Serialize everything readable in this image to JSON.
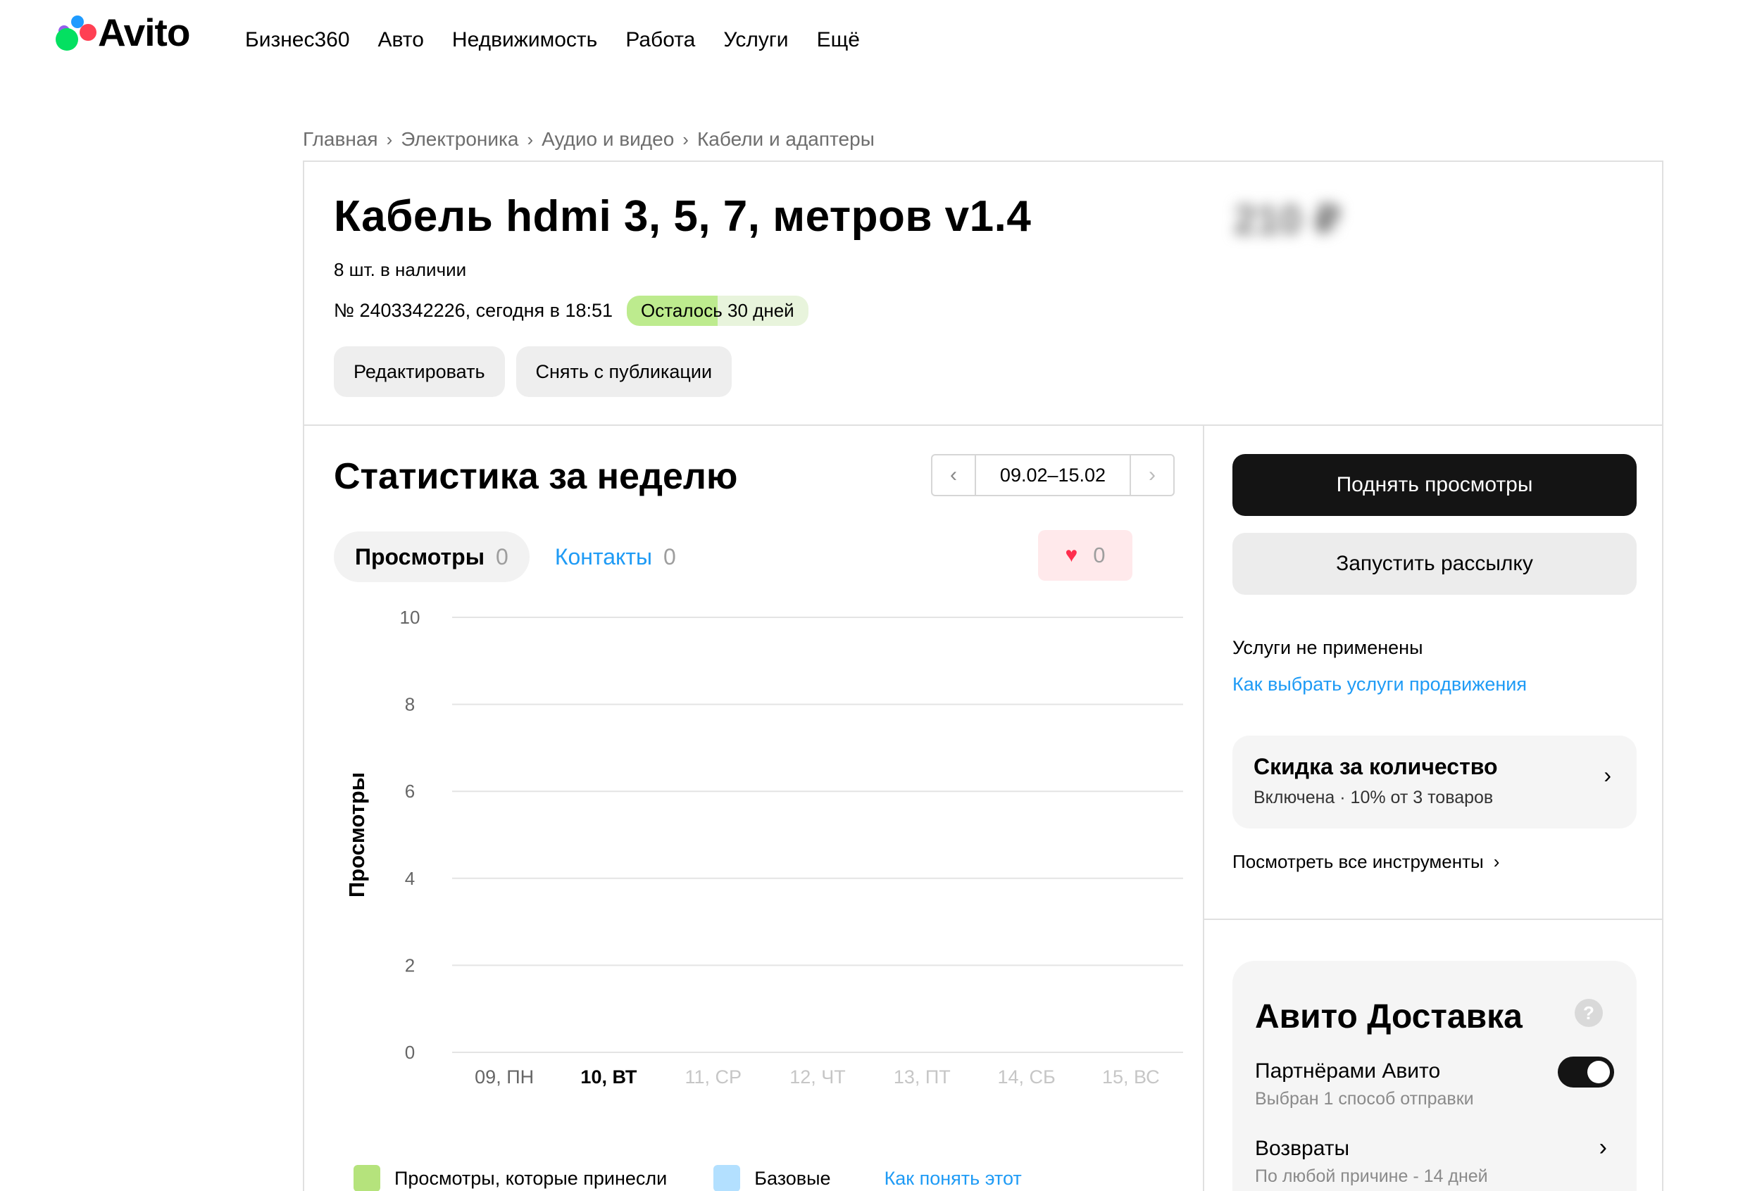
{
  "header": {
    "logo_text": "Avito",
    "nav": [
      "Бизнес360",
      "Авто",
      "Недвижимость",
      "Работа",
      "Услуги",
      "Ещё"
    ]
  },
  "breadcrumb": [
    "Главная",
    "Электроника",
    "Аудио и видео",
    "Кабели и адаптеры"
  ],
  "listing": {
    "title": "Кабель hdmi 3, 5, 7, метров v1.4",
    "price": "210 ₽",
    "stock": "8 шт. в наличии",
    "meta": "№ 2403342226, сегодня в 18:51",
    "days_left": "Осталось 30 дней",
    "edit_label": "Редактировать",
    "unpublish_label": "Снять с публикации"
  },
  "stats": {
    "title": "Статистика за неделю",
    "date_range": "09.02–15.02",
    "tab_views": "Просмотры",
    "tab_views_count": "0",
    "tab_contacts": "Контакты",
    "tab_contacts_count": "0",
    "favorites_count": "0",
    "legend_paid": "Просмотры, которые принесли",
    "legend_base": "Базовые",
    "legend_link": "Как понять этот"
  },
  "chart_data": {
    "type": "bar",
    "ylabel": "Просмотры",
    "ylim": [
      0,
      10
    ],
    "yticks": [
      "0",
      "2",
      "4",
      "6",
      "8",
      "10"
    ],
    "categories": [
      "09, ПН",
      "10, ВТ",
      "11, СР",
      "12, ЧТ",
      "13, ПТ",
      "14, СБ",
      "15, ВС"
    ],
    "active_category": "10, ВТ",
    "series": [
      {
        "name": "Просмотры, которые принесли",
        "color": "#b5e37c",
        "values": [
          0,
          0,
          0,
          0,
          0,
          0,
          0
        ]
      },
      {
        "name": "Базовые",
        "color": "#b3e0ff",
        "values": [
          0,
          0,
          0,
          0,
          0,
          0,
          0
        ]
      }
    ],
    "grid": true
  },
  "side": {
    "boost_label": "Поднять просмотры",
    "mailing_label": "Запустить рассылку",
    "no_services": "Услуги не применены",
    "how_link": "Как выбрать услуги продвижения",
    "discount_title": "Скидка за количество",
    "discount_sub": "Включена · 10% от 3 товаров",
    "all_tools": "Посмотреть все инструменты",
    "delivery_title": "Авито Доставка",
    "partners_label": "Партнёрами Авито",
    "partners_sub": "Выбран 1 способ отправки",
    "returns_label": "Возвраты",
    "returns_sub": "По любой причине - 14 дней"
  },
  "colors": {
    "accent_link": "#1f9bf5",
    "badge_green": "#bdeb8e",
    "dark_button": "#141414"
  }
}
